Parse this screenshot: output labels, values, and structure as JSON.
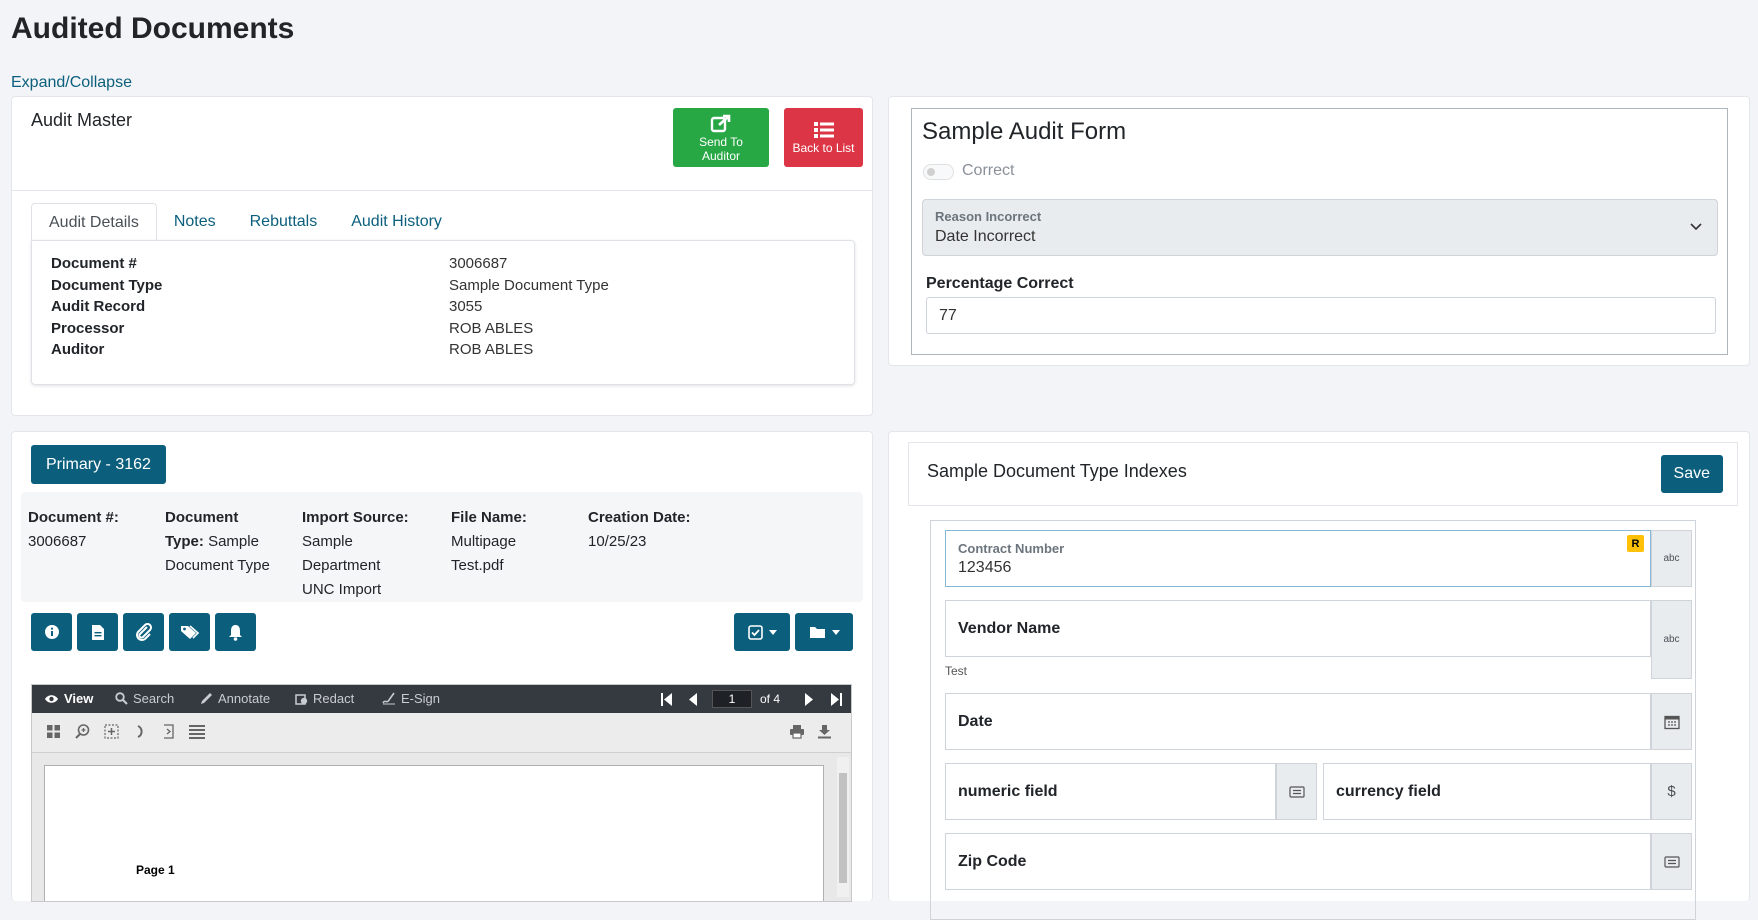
{
  "page": {
    "title": "Audited Documents",
    "expand_collapse": "Expand/Collapse"
  },
  "audit_master": {
    "title": "Audit Master",
    "send_to_auditor": "Send To Auditor",
    "back_to_list": "Back to List",
    "tabs": [
      {
        "label": "Audit Details",
        "active": true
      },
      {
        "label": "Notes",
        "active": false
      },
      {
        "label": "Rebuttals",
        "active": false
      },
      {
        "label": "Audit History",
        "active": false
      }
    ],
    "details": [
      {
        "label": "Document #",
        "value": "3006687"
      },
      {
        "label": "Document Type",
        "value": "Sample Document Type"
      },
      {
        "label": "Audit Record",
        "value": "3055"
      },
      {
        "label": "Processor",
        "value": "ROB ABLES"
      },
      {
        "label": "Auditor",
        "value": "ROB ABLES"
      }
    ]
  },
  "audit_form": {
    "title": "Sample Audit Form",
    "correct_label": "Correct",
    "correct_checked": false,
    "reason_label": "Reason Incorrect",
    "reason_value": "Date Incorrect",
    "percentage_label": "Percentage Correct",
    "percentage_value": "77"
  },
  "primary_doc": {
    "button": "Primary - 3162",
    "meta": {
      "doc_num_label": "Document #:",
      "doc_num_value": "3006687",
      "doc_type_label_1": "Document",
      "doc_type_label_2": "Type:",
      "doc_type_value_1": "Sample",
      "doc_type_value_2": "Document Type",
      "import_source_label": "Import Source:",
      "import_source_lines": [
        "Sample",
        "Department",
        "UNC Import"
      ],
      "file_name_label": "File Name:",
      "file_name_lines": [
        "Multipage",
        "Test.pdf"
      ],
      "creation_date_label": "Creation Date:",
      "creation_date_value": "10/25/23"
    },
    "icon_buttons": [
      "info-icon",
      "file-icon",
      "paperclip-icon",
      "tags-icon",
      "bell-icon"
    ],
    "dropdown_buttons": [
      "check-square-icon",
      "folder-icon"
    ]
  },
  "viewer": {
    "tools": [
      {
        "label": "View",
        "icon": "eye-icon",
        "active": true
      },
      {
        "label": "Search",
        "icon": "search-icon",
        "active": false
      },
      {
        "label": "Annotate",
        "icon": "pen-icon",
        "active": false
      },
      {
        "label": "Redact",
        "icon": "redact-icon",
        "active": false
      },
      {
        "label": "E-Sign",
        "icon": "signature-icon",
        "active": false
      }
    ],
    "current_page": "1",
    "page_of": "of 4",
    "page_label": "Page 1"
  },
  "indexes": {
    "title": "Sample Document Type Indexes",
    "save": "Save",
    "contract_label": "Contract Number",
    "contract_value": "123456",
    "required_badge": "R",
    "abc": "abc",
    "vendor_label": "Vendor Name",
    "vendor_helper": "Test",
    "date_label": "Date",
    "numeric_label": "numeric field",
    "currency_label": "currency field",
    "currency_symbol": "$",
    "zip_label": "Zip Code"
  },
  "colors": {
    "primary": "#0b5f7c",
    "success": "#28a745",
    "danger": "#dc3545",
    "badge": "#ffc107"
  }
}
